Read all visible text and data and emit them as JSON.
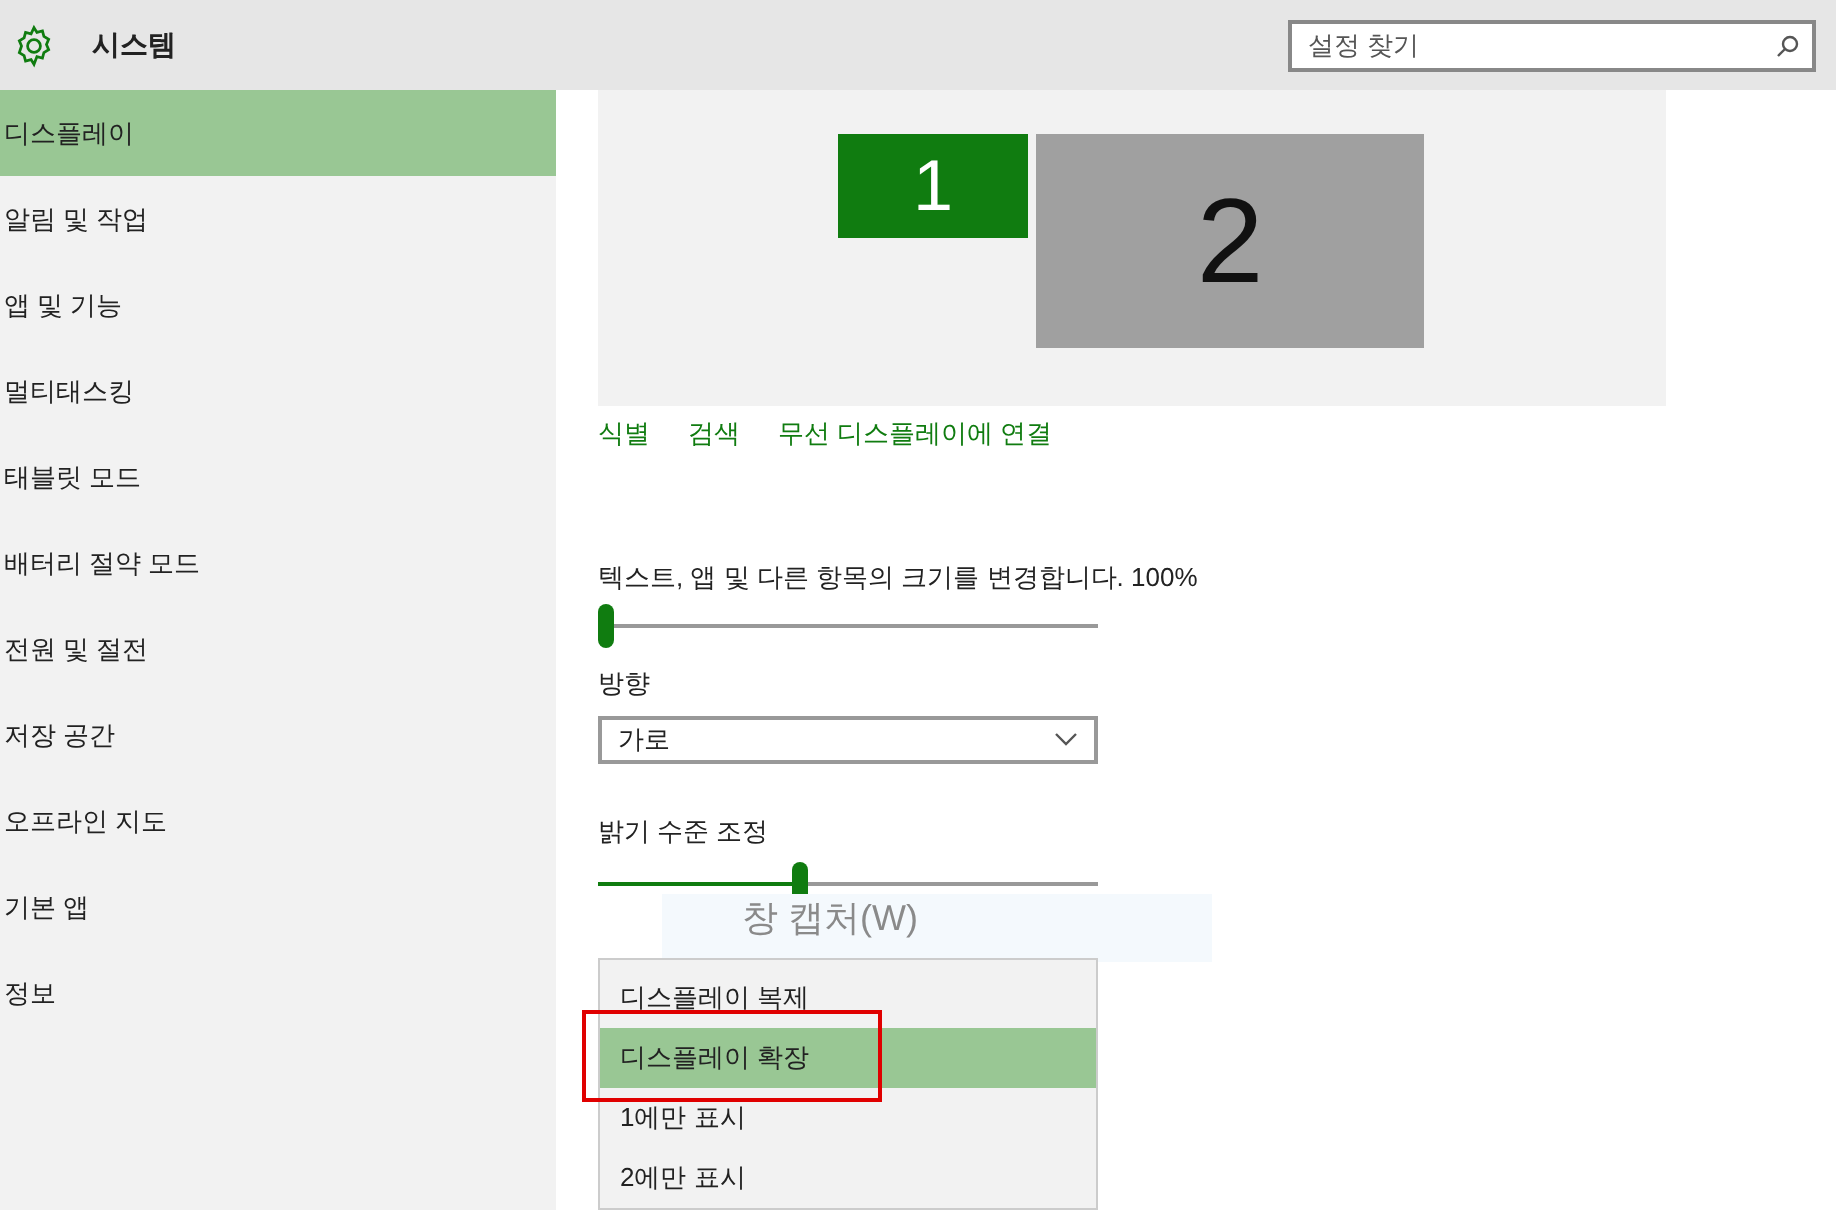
{
  "header": {
    "title": "시스템",
    "search": {
      "placeholder": "설정 찾기"
    }
  },
  "sidebar": {
    "items": [
      {
        "label": "디스플레이",
        "selected": true
      },
      {
        "label": "알림 및 작업",
        "selected": false
      },
      {
        "label": "앱 및 기능",
        "selected": false
      },
      {
        "label": "멀티태스킹",
        "selected": false
      },
      {
        "label": "태블릿 모드",
        "selected": false
      },
      {
        "label": "배터리 절약 모드",
        "selected": false
      },
      {
        "label": "전원 및 절전",
        "selected": false
      },
      {
        "label": "저장 공간",
        "selected": false
      },
      {
        "label": "오프라인 지도",
        "selected": false
      },
      {
        "label": "기본 앱",
        "selected": false
      },
      {
        "label": "정보",
        "selected": false
      }
    ]
  },
  "preview": {
    "monitors": [
      {
        "label": "1",
        "selected": true
      },
      {
        "label": "2",
        "selected": false
      }
    ]
  },
  "links": [
    "식별",
    "검색",
    "무선 디스플레이에 연결"
  ],
  "scale": {
    "label": "텍스트, 앱 및 다른 항목의 크기를 변경합니다. 100%",
    "level": 0
  },
  "orientation": {
    "label": "방향",
    "value": "가로"
  },
  "brightness": {
    "label": "밝기 수준 조정",
    "level": 0.4
  },
  "tooltip": {
    "text": "창 캡처(W)"
  },
  "multiple_displays": {
    "options": [
      {
        "label": "디스플레이 복제",
        "selected": false
      },
      {
        "label": "디스플레이 확장",
        "selected": true
      },
      {
        "label": "1에만 표시",
        "selected": false
      },
      {
        "label": "2에만 표시",
        "selected": false
      }
    ]
  }
}
